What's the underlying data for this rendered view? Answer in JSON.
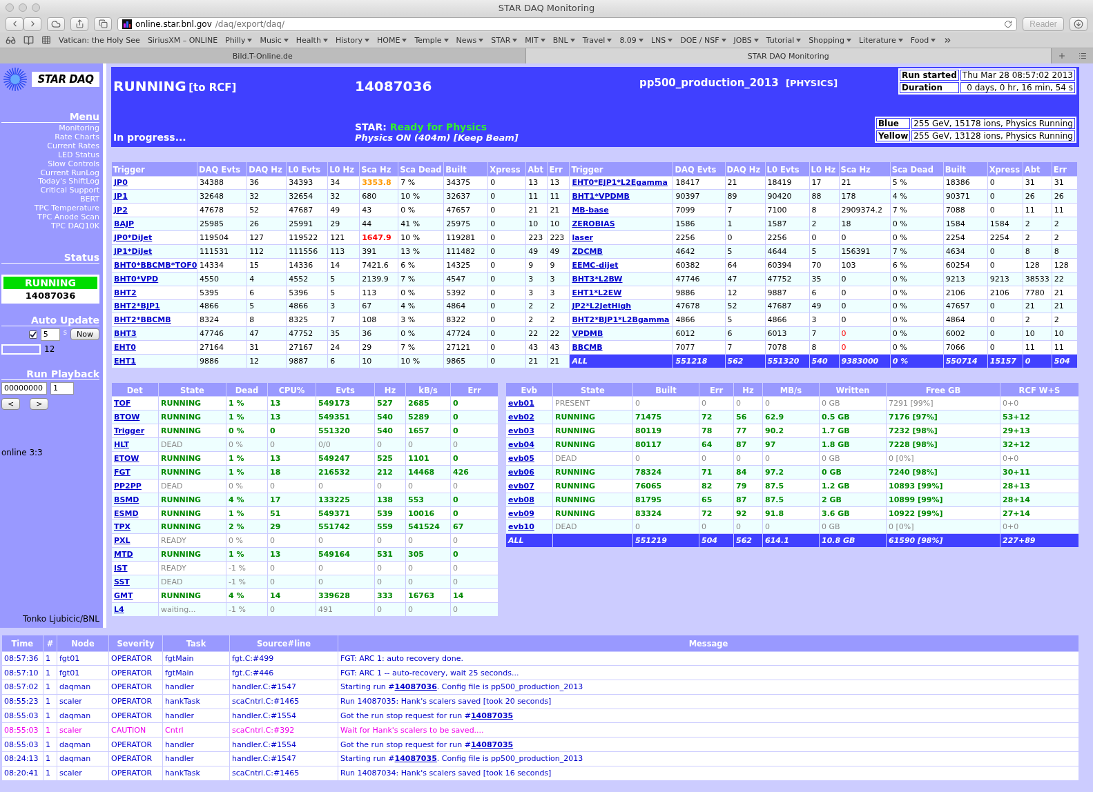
{
  "browser": {
    "title": "STAR DAQ Monitoring",
    "url_host": "online.star.bnl.gov",
    "url_path": "/daq/export/daq/",
    "reader": "Reader",
    "bookmarks": [
      {
        "label": "Vatican: the Holy See",
        "menu": false
      },
      {
        "label": "SiriusXM – ONLINE",
        "menu": false
      },
      {
        "label": "Philly",
        "menu": true
      },
      {
        "label": "Music",
        "menu": true
      },
      {
        "label": "Health",
        "menu": true
      },
      {
        "label": "History",
        "menu": true
      },
      {
        "label": "HOME",
        "menu": true
      },
      {
        "label": "Temple",
        "menu": true
      },
      {
        "label": "News",
        "menu": true
      },
      {
        "label": "STAR",
        "menu": true
      },
      {
        "label": "MIT",
        "menu": true
      },
      {
        "label": "BNL",
        "menu": true
      },
      {
        "label": "Travel",
        "menu": true
      },
      {
        "label": "8.09",
        "menu": true
      },
      {
        "label": "LNS",
        "menu": true
      },
      {
        "label": "DOE / NSF",
        "menu": true
      },
      {
        "label": "JOBS",
        "menu": true
      },
      {
        "label": "Tutorial",
        "menu": true
      },
      {
        "label": "Shopping",
        "menu": true
      },
      {
        "label": "Literature",
        "menu": true
      },
      {
        "label": "Food",
        "menu": true
      }
    ],
    "tabs": [
      {
        "label": "Bild.T-Online.de",
        "selected": false
      },
      {
        "label": "STAR DAQ Monitoring",
        "selected": true
      }
    ]
  },
  "sidebar": {
    "logo_text": "STAR DAQ",
    "menu_title": "Menu",
    "menu": [
      "Monitoring",
      "Rate Charts",
      "Current Rates",
      "LED Status",
      "Slow Controls",
      "Current RunLog",
      "Today's ShiftLog",
      "Critical Support",
      "BERT",
      "TPC Temperature",
      "TPC Anode Scan",
      "TPC DAQ10K"
    ],
    "status_title": "Status",
    "status": {
      "state": "RUNNING",
      "run": "14087036"
    },
    "auto_update": {
      "title": "Auto Update",
      "checked": true,
      "interval": "5",
      "unit": "s",
      "button": "Now",
      "countdown": "12"
    },
    "playback": {
      "title": "Run Playback",
      "run": "00000000",
      "step": "1",
      "buttons": [
        "<",
        ">"
      ]
    },
    "online": "online 3:3",
    "author": "Tonko Ljubicic/BNL"
  },
  "header": {
    "state": "RUNNING",
    "destination": "[to RCF]",
    "progress": "In progress...",
    "run_number": "14087036",
    "star_label": "STAR:",
    "star_status": "Ready for Physics",
    "beam_status": "Physics ON (404m) [Keep Beam]",
    "config": "pp500_production_2013",
    "run_type": "[PHYSICS]",
    "run_info": [
      {
        "label": "Run started",
        "value": "Thu Mar 28 08:57:02 2013"
      },
      {
        "label": "Duration",
        "value": "0 days, 0 hr, 16 min, 54 s"
      }
    ],
    "beams": [
      {
        "label": "Blue",
        "value": "255 GeV, 15178 ions, Physics Running"
      },
      {
        "label": "Yellow",
        "value": "255 GeV, 13128 ions, Physics Running"
      }
    ]
  },
  "triggers": {
    "columns": [
      "Trigger",
      "DAQ Evts",
      "DAQ Hz",
      "L0 Evts",
      "L0 Hz",
      "Sca Hz",
      "Sca Dead",
      "Built",
      "Xpress",
      "Abt",
      "Err"
    ],
    "columns_right": [
      "Trigger",
      "DAQ Evts",
      "DAQ Hz",
      "L0 Evts",
      "L0 Hz",
      "Sca Hz",
      "Sca Dead",
      "Built",
      "Xpress",
      "Abt",
      "Err"
    ],
    "rows": [
      {
        "cells": [
          "JP0",
          "34388",
          "36",
          "34393",
          "34",
          "3353.8",
          "7 %",
          "34375",
          "0",
          "13",
          "13"
        ],
        "kind": "warning"
      },
      {
        "cells": [
          "JP1",
          "32648",
          "32",
          "32654",
          "32",
          "680",
          "10 %",
          "32637",
          "0",
          "11",
          "11"
        ],
        "kind": "normal"
      },
      {
        "cells": [
          "JP2",
          "47678",
          "52",
          "47687",
          "49",
          "43",
          "0 %",
          "47657",
          "0",
          "21",
          "21"
        ],
        "kind": "normal"
      },
      {
        "cells": [
          "BAJP",
          "25985",
          "26",
          "25991",
          "29",
          "44",
          "41 %",
          "25975",
          "0",
          "10",
          "10"
        ],
        "kind": "normal"
      },
      {
        "cells": [
          "JP0*DiJet",
          "119504",
          "127",
          "119522",
          "121",
          "1647.9",
          "10 %",
          "119281",
          "0",
          "223",
          "223"
        ],
        "kind": "alarm"
      },
      {
        "cells": [
          "JP1*DiJet",
          "111531",
          "112",
          "111556",
          "113",
          "391",
          "13 %",
          "111482",
          "0",
          "49",
          "49"
        ],
        "kind": "normal"
      },
      {
        "cells": [
          "BHT0*BBCMB*TOF0",
          "14334",
          "15",
          "14336",
          "14",
          "7421.6",
          "6 %",
          "14325",
          "0",
          "9",
          "9"
        ],
        "kind": "normal"
      },
      {
        "cells": [
          "BHT0*VPD",
          "4550",
          "4",
          "4552",
          "5",
          "2139.9",
          "7 %",
          "4547",
          "0",
          "3",
          "3"
        ],
        "kind": "normal"
      },
      {
        "cells": [
          "BHT2",
          "5395",
          "6",
          "5396",
          "5",
          "113",
          "0 %",
          "5392",
          "0",
          "3",
          "3"
        ],
        "kind": "normal"
      },
      {
        "cells": [
          "BHT2*BJP1",
          "4866",
          "5",
          "4866",
          "3",
          "67",
          "4 %",
          "4864",
          "0",
          "2",
          "2"
        ],
        "kind": "normal"
      },
      {
        "cells": [
          "BHT2*BBCMB",
          "8324",
          "8",
          "8325",
          "7",
          "108",
          "3 %",
          "8322",
          "0",
          "2",
          "2"
        ],
        "kind": "normal"
      },
      {
        "cells": [
          "BHT3",
          "47746",
          "47",
          "47752",
          "35",
          "36",
          "0 %",
          "47724",
          "0",
          "22",
          "22"
        ],
        "kind": "normal"
      },
      {
        "cells": [
          "EHT0",
          "27164",
          "31",
          "27167",
          "24",
          "29",
          "7 %",
          "27121",
          "0",
          "43",
          "43"
        ],
        "kind": "normal"
      },
      {
        "cells": [
          "EHT1",
          "9886",
          "12",
          "9887",
          "6",
          "10",
          "10 %",
          "9865",
          "0",
          "21",
          "21"
        ],
        "kind": "normal"
      }
    ],
    "rows_right": [
      {
        "cells": [
          "EHT0*EJP1*L2Egamma",
          "18417",
          "21",
          "18419",
          "17",
          "21",
          "5 %",
          "18386",
          "0",
          "31",
          "31"
        ],
        "kind": "normal"
      },
      {
        "cells": [
          "BHT1*VPDMB",
          "90397",
          "89",
          "90420",
          "88",
          "178",
          "4 %",
          "90371",
          "0",
          "26",
          "26"
        ],
        "kind": "normal"
      },
      {
        "cells": [
          "MB-base",
          "7099",
          "7",
          "7100",
          "8",
          "2909374.2",
          "7 %",
          "7088",
          "0",
          "11",
          "11"
        ],
        "kind": "normal"
      },
      {
        "cells": [
          "ZEROBIAS",
          "1586",
          "1",
          "1587",
          "2",
          "18",
          "0 %",
          "1584",
          "1584",
          "2",
          "2"
        ],
        "kind": "normal"
      },
      {
        "cells": [
          "laser",
          "2256",
          "0",
          "2256",
          "0",
          "0",
          "0 %",
          "2254",
          "2254",
          "2",
          "2"
        ],
        "kind": "normal"
      },
      {
        "cells": [
          "ZDCMB",
          "4642",
          "5",
          "4644",
          "5",
          "156391",
          "7 %",
          "4634",
          "0",
          "8",
          "8"
        ],
        "kind": "normal"
      },
      {
        "cells": [
          "EEMC-dijet",
          "60382",
          "64",
          "60394",
          "70",
          "103",
          "6 %",
          "60254",
          "0",
          "128",
          "128"
        ],
        "kind": "normal"
      },
      {
        "cells": [
          "BHT3*L2BW",
          "47746",
          "47",
          "47752",
          "35",
          "0",
          "0 %",
          "9213",
          "9213",
          "38533",
          "22"
        ],
        "kind": "normal"
      },
      {
        "cells": [
          "EHT1*L2EW",
          "9886",
          "12",
          "9887",
          "6",
          "0",
          "0 %",
          "2106",
          "2106",
          "7780",
          "21"
        ],
        "kind": "normal"
      },
      {
        "cells": [
          "JP2*L2JetHigh",
          "47678",
          "52",
          "47687",
          "49",
          "0",
          "0 %",
          "47657",
          "0",
          "21",
          "21"
        ],
        "kind": "normal"
      },
      {
        "cells": [
          "BHT2*BJP1*L2Bgamma",
          "4866",
          "5",
          "4866",
          "3",
          "0",
          "0 %",
          "4864",
          "0",
          "2",
          "2"
        ],
        "kind": "normal"
      },
      {
        "cells": [
          "VPDMB",
          "6012",
          "6",
          "6013",
          "7",
          "0",
          "0 %",
          "6002",
          "0",
          "10",
          "10"
        ],
        "kind": "low"
      },
      {
        "cells": [
          "BBCMB",
          "7077",
          "7",
          "7078",
          "8",
          "0",
          "0 %",
          "7066",
          "0",
          "11",
          "11"
        ],
        "kind": "low"
      }
    ],
    "total": [
      "ALL",
      "551218",
      "562",
      "551320",
      "540",
      "9383000",
      "0 %",
      "550714",
      "15157",
      "0",
      "504"
    ]
  },
  "detectors": {
    "columns": [
      "Det",
      "State",
      "Dead",
      "CPU%",
      "Evts",
      "Hz",
      "kB/s",
      "Err"
    ],
    "rows": [
      {
        "cells": [
          "TOF",
          "RUNNING",
          "1 %",
          "13",
          "549173",
          "527",
          "2685",
          "0"
        ],
        "kind": "running"
      },
      {
        "cells": [
          "BTOW",
          "RUNNING",
          "1 %",
          "13",
          "549351",
          "540",
          "5289",
          "0"
        ],
        "kind": "running"
      },
      {
        "cells": [
          "Trigger",
          "RUNNING",
          "0 %",
          "0",
          "551320",
          "540",
          "1657",
          "0"
        ],
        "kind": "running"
      },
      {
        "cells": [
          "HLT",
          "DEAD",
          "0 %",
          "0",
          "0/0",
          "0",
          "0",
          "0"
        ],
        "kind": "idle"
      },
      {
        "cells": [
          "ETOW",
          "RUNNING",
          "1 %",
          "13",
          "549247",
          "525",
          "1101",
          "0"
        ],
        "kind": "running"
      },
      {
        "cells": [
          "FGT",
          "RUNNING",
          "1 %",
          "18",
          "216532",
          "212",
          "14468",
          "426"
        ],
        "kind": "running"
      },
      {
        "cells": [
          "PP2PP",
          "DEAD",
          "0 %",
          "0",
          "0",
          "0",
          "0",
          "0"
        ],
        "kind": "idle"
      },
      {
        "cells": [
          "BSMD",
          "RUNNING",
          "4 %",
          "17",
          "133225",
          "138",
          "553",
          "0"
        ],
        "kind": "running"
      },
      {
        "cells": [
          "ESMD",
          "RUNNING",
          "1 %",
          "51",
          "549371",
          "539",
          "10016",
          "0"
        ],
        "kind": "running"
      },
      {
        "cells": [
          "TPX",
          "RUNNING",
          "2 %",
          "29",
          "551742",
          "559",
          "541524",
          "67"
        ],
        "kind": "running"
      },
      {
        "cells": [
          "PXL",
          "READY",
          "0 %",
          "0",
          "0",
          "0",
          "0",
          "0"
        ],
        "kind": "idle"
      },
      {
        "cells": [
          "MTD",
          "RUNNING",
          "1 %",
          "13",
          "549164",
          "531",
          "305",
          "0"
        ],
        "kind": "running"
      },
      {
        "cells": [
          "IST",
          "READY",
          "-1 %",
          "0",
          "0",
          "0",
          "0",
          "0"
        ],
        "kind": "idle"
      },
      {
        "cells": [
          "SST",
          "DEAD",
          "-1 %",
          "0",
          "0",
          "0",
          "0",
          "0"
        ],
        "kind": "idle"
      },
      {
        "cells": [
          "GMT",
          "RUNNING",
          "4 %",
          "14",
          "339628",
          "333",
          "16763",
          "14"
        ],
        "kind": "running"
      },
      {
        "cells": [
          "L4",
          "waiting...",
          "-1 %",
          "0",
          "491",
          "0",
          "0",
          "0"
        ],
        "kind": "idle"
      }
    ]
  },
  "event_builders": {
    "columns": [
      "Evb",
      "State",
      "Built",
      "Err",
      "Hz",
      "MB/s",
      "Written",
      "Free GB",
      "RCF W+S"
    ],
    "rows": [
      {
        "cells": [
          "evb01",
          "PRESENT",
          "0",
          "0",
          "0",
          "0",
          "0 GB",
          "7291 [99%]",
          "0+0"
        ],
        "kind": "idle"
      },
      {
        "cells": [
          "evb02",
          "RUNNING",
          "71475",
          "72",
          "56",
          "62.9",
          "0.5 GB",
          "7176 [97%]",
          "53+12"
        ],
        "kind": "running"
      },
      {
        "cells": [
          "evb03",
          "RUNNING",
          "80119",
          "78",
          "77",
          "90.2",
          "1.7 GB",
          "7232 [98%]",
          "29+13"
        ],
        "kind": "running"
      },
      {
        "cells": [
          "evb04",
          "RUNNING",
          "80117",
          "64",
          "87",
          "97",
          "1.8 GB",
          "7228 [98%]",
          "32+12"
        ],
        "kind": "running"
      },
      {
        "cells": [
          "evb05",
          "DEAD",
          "0",
          "0",
          "0",
          "0",
          "0 GB",
          "0 [0%]",
          "0+0"
        ],
        "kind": "idle"
      },
      {
        "cells": [
          "evb06",
          "RUNNING",
          "78324",
          "71",
          "84",
          "97.2",
          "0 GB",
          "7240 [98%]",
          "30+11"
        ],
        "kind": "running"
      },
      {
        "cells": [
          "evb07",
          "RUNNING",
          "76065",
          "82",
          "79",
          "87.5",
          "1.2 GB",
          "10893 [99%]",
          "28+13"
        ],
        "kind": "running"
      },
      {
        "cells": [
          "evb08",
          "RUNNING",
          "81795",
          "65",
          "87",
          "87.5",
          "2 GB",
          "10899 [99%]",
          "28+14"
        ],
        "kind": "running"
      },
      {
        "cells": [
          "evb09",
          "RUNNING",
          "83324",
          "72",
          "92",
          "91.8",
          "3.6 GB",
          "10922 [99%]",
          "27+14"
        ],
        "kind": "running"
      },
      {
        "cells": [
          "evb10",
          "DEAD",
          "0",
          "0",
          "0",
          "0",
          "0 GB",
          "0 [0%]",
          "0+0"
        ],
        "kind": "idle"
      }
    ],
    "total": {
      "label": "ALL",
      "cells": [
        "551219",
        "504",
        "562",
        "614.1",
        "10.8 GB",
        "61590 [98%]",
        "227+89"
      ]
    }
  },
  "messages": {
    "columns": [
      "Time",
      "#",
      "Node",
      "Severity",
      "Task",
      "Source#line",
      "Message"
    ],
    "rows": [
      {
        "time": "08:57:36",
        "count": "1",
        "node": "fgt01",
        "severity": "OPERATOR",
        "task": "fgtMain",
        "source": "fgt.C:#499",
        "text": "FGT: ARC 1: auto recovery done.",
        "kind": "operator"
      },
      {
        "time": "08:57:10",
        "count": "1",
        "node": "fgt01",
        "severity": "OPERATOR",
        "task": "fgtMain",
        "source": "fgt.C:#446",
        "text": "FGT: ARC 1 -- auto-recovery, wait 25 seconds...",
        "kind": "operator"
      },
      {
        "time": "08:57:02",
        "count": "1",
        "node": "daqman",
        "severity": "OPERATOR",
        "task": "handler",
        "source": "handler.C:#1547",
        "text": "Starting run #",
        "link": "14087036",
        "text_end": ". Config file is pp500_production_2013",
        "kind": "operator"
      },
      {
        "time": "08:55:23",
        "count": "1",
        "node": "scaler",
        "severity": "OPERATOR",
        "task": "hankTask",
        "source": "scaCntrl.C:#1465",
        "text": "Run 14087035: Hank's scalers saved [took 20 seconds]",
        "kind": "operator"
      },
      {
        "time": "08:55:03",
        "count": "1",
        "node": "daqman",
        "severity": "OPERATOR",
        "task": "handler",
        "source": "handler.C:#1554",
        "text": "Got the run stop request for run #",
        "link": "14087035",
        "kind": "operator"
      },
      {
        "time": "08:55:03",
        "count": "1",
        "node": "scaler",
        "severity": "CAUTION",
        "task": "Cntrl",
        "source": "scaCntrl.C:#392",
        "text": "Wait for Hank's scalers to be saved....",
        "kind": "caution"
      },
      {
        "time": "08:55:03",
        "count": "1",
        "node": "daqman",
        "severity": "OPERATOR",
        "task": "handler",
        "source": "handler.C:#1554",
        "text": "Got the run stop request for run #",
        "link": "14087035",
        "kind": "operator"
      },
      {
        "time": "08:24:13",
        "count": "1",
        "node": "daqman",
        "severity": "OPERATOR",
        "task": "handler",
        "source": "handler.C:#1547",
        "text": "Starting run #",
        "link": "14087035",
        "text_end": ". Config file is pp500_production_2013",
        "kind": "operator"
      },
      {
        "time": "08:20:41",
        "count": "1",
        "node": "scaler",
        "severity": "OPERATOR",
        "task": "hankTask",
        "source": "scaCntrl.C:#1465",
        "text": "Run 14087034: Hank's scalers saved [took 16 seconds]",
        "kind": "operator"
      }
    ]
  }
}
